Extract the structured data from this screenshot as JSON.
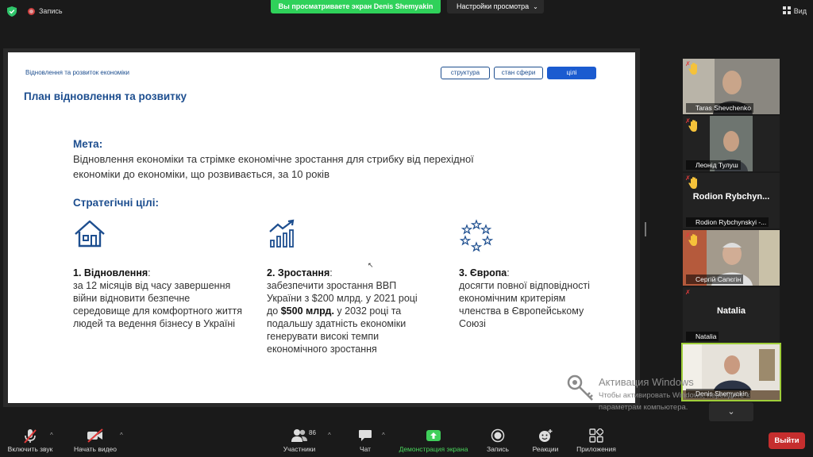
{
  "top_bar": {
    "record_label": "Запись",
    "share_banner": "Вы просматриваете экран Denis Shemyakin",
    "view_settings": "Настройки просмотра",
    "view_label": "Вид"
  },
  "slide": {
    "breadcrumb": "Відновлення та розвиток економіки",
    "tabs": [
      {
        "label": "структура",
        "active": false
      },
      {
        "label": "стан сфери",
        "active": false
      },
      {
        "label": "цілі",
        "active": true
      }
    ],
    "title": "План відновлення та розвитку",
    "goal_heading": "Мета:",
    "goal_text": "Відновлення економіки та стрімке економічне зростання для стрибку від перехідної економіки до економіки, що розвивається, за 10 років",
    "strategic_heading": "Стратегічні цілі:",
    "goals": [
      {
        "icon": "house-icon",
        "title": "1. Відновлення",
        "suffix": ":",
        "text": "за 12 місяців від часу завершення війни відновити безпечне середовище для комфортного життя людей та ведення бізнесу в Україні"
      },
      {
        "icon": "growth-chart-icon",
        "title": "2. Зростання",
        "suffix": ":",
        "text_before": "забезпечити зростання ВВП України з $200 млрд. у 2021 році до ",
        "text_bold": "$500 млрд.",
        "text_after": " у 2032 році та подальшу здатність економіки генерувати високі темпи економічного зростання"
      },
      {
        "icon": "eu-stars-icon",
        "title": "3. Європа",
        "suffix": ":",
        "text": "досягти повної відповідності економічним критеріям членства в Європейському Союзі"
      }
    ]
  },
  "participants": [
    {
      "name": "Taras Shevchenko",
      "hand_raised": true,
      "muted": true,
      "video": true
    },
    {
      "name": "Леонід Тулуш",
      "hand_raised": true,
      "muted": true,
      "video": true
    },
    {
      "name": "Rodion Rybchynskyi -...",
      "display_name": "Rodion  Rybchyn...",
      "hand_raised": true,
      "muted": true,
      "video": false
    },
    {
      "name": "Сергій Сапєгін",
      "hand_raised": true,
      "muted": true,
      "video": true
    },
    {
      "name": "Natalia",
      "display_name": "Natalia",
      "hand_raised": false,
      "muted": true,
      "video": false
    },
    {
      "name": "Denis Shemyakin",
      "hand_raised": false,
      "muted": false,
      "video": true,
      "speaking": true
    }
  ],
  "watermark": {
    "title": "Активация Windows",
    "line1": "Чтобы активировать Windows, перейдите к",
    "line2": "параметрам компьютера."
  },
  "toolbar": {
    "mute": "Включить звук",
    "video": "Начать видео",
    "participants": "Участники",
    "participants_count": "86",
    "chat": "Чат",
    "share": "Демонстрация экрана",
    "record": "Запись",
    "reactions": "Реакции",
    "apps": "Приложения",
    "leave": "Выйти"
  },
  "colors": {
    "accent_blue": "#1d4e8f",
    "tab_active": "#1b5bd0",
    "share_green": "#2fd15a",
    "leave_red": "#c62e2e",
    "speaker_outline": "#9fce3a"
  }
}
